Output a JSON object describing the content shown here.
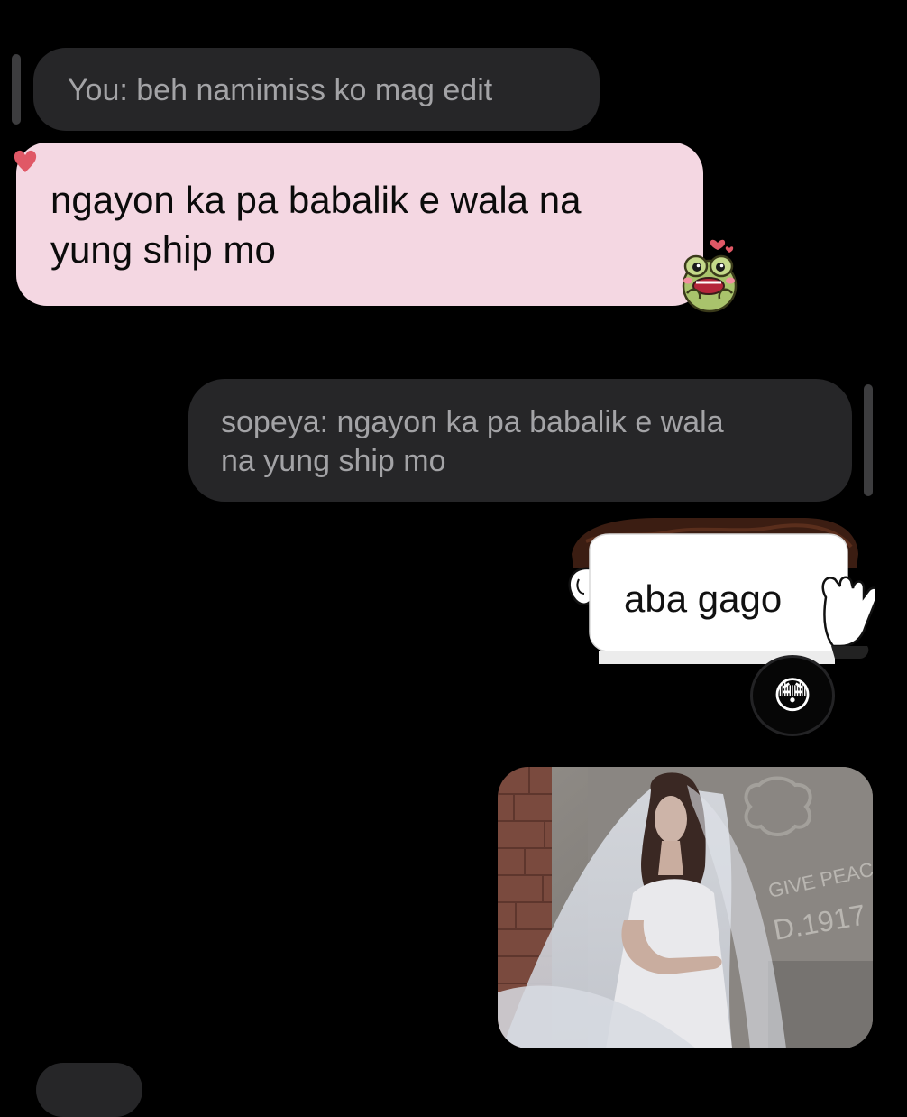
{
  "messages": {
    "reply_1": {
      "quote": "You: beh namimiss ko mag edit"
    },
    "incoming_1": {
      "line1": "ngayon ka pa babalik e wala na",
      "line2": "yung ship mo",
      "reaction": "heart-icon",
      "sticker": "frog-sticker"
    },
    "reply_2": {
      "quote_line1": "sopeya: ngayon ka pa babalik e wala",
      "quote_line2": "na yung ship mo"
    },
    "outgoing_1": {
      "text": "aba gago",
      "reaction_emoji": "😳"
    },
    "outgoing_photo": {
      "engraved_text_1": "GIVE PEAC",
      "engraved_text_2": "D.1917"
    }
  },
  "colors": {
    "background": "#000000",
    "quote_bubble": "#262628",
    "quote_text": "#a3a3a6",
    "pink_bubble": "#f4d7e2",
    "heart": "#e05866"
  }
}
